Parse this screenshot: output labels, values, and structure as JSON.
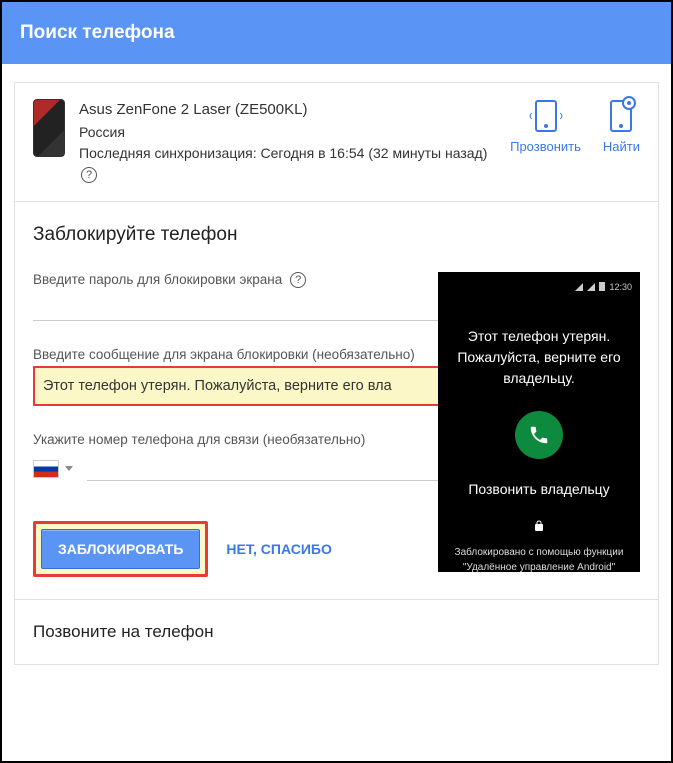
{
  "header": {
    "title": "Поиск телефона"
  },
  "device": {
    "name": "Asus ZenFone 2 Laser (ZE500KL)",
    "country": "Россия",
    "last_sync": "Последняя синхронизация: Сегодня в 16:54 (32 минуты назад)"
  },
  "actions": {
    "ring_label": "Прозвонить",
    "locate_label": "Найти"
  },
  "lock_section": {
    "title": "Заблокируйте телефон",
    "password_label": "Введите пароль для блокировки экрана",
    "message_label": "Введите сообщение для экрана блокировки (необязательно)",
    "message_value": "Этот телефон утерян. Пожалуйста, верните его вла",
    "phone_label": "Укажите номер телефона для связи (необязательно)",
    "lock_button": "ЗАБЛОКИРОВАТЬ",
    "no_thanks": "НЕТ, СПАСИБО"
  },
  "preview": {
    "time": "12:30",
    "message": "Этот телефон утерян. Пожалуйста, верните его владельцу.",
    "call_owner": "Позвонить владельцу",
    "locked_by": "Заблокировано с помощью функции",
    "locked_by2": "\"Удалённое управление Android\""
  },
  "call_section": {
    "title": "Позвоните на телефон"
  }
}
